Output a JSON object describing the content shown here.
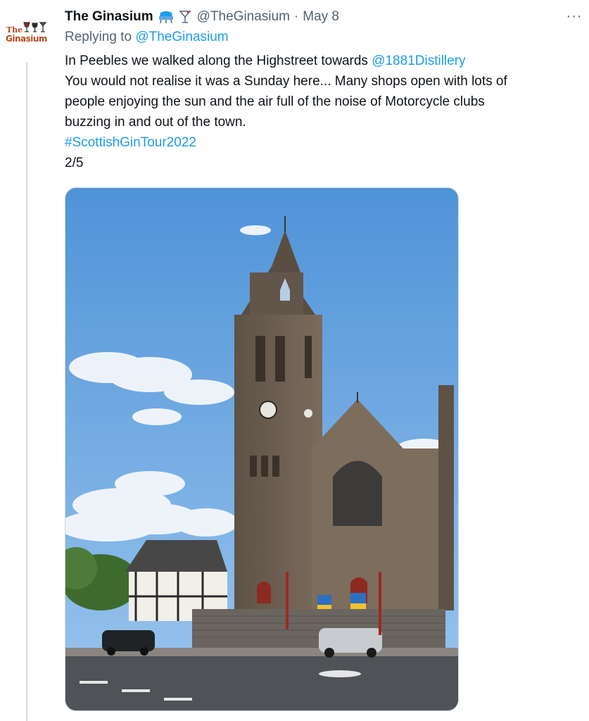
{
  "tweet": {
    "display_name": "The Ginasium",
    "handle": "@TheGinasium",
    "separator": "·",
    "date": "May 8",
    "replying_prefix": "Replying to",
    "replying_to": "@TheGinasium",
    "text": {
      "line1_prefix": "In Peebles we walked along the Highstreet towards ",
      "line1_mention": "@1881Distillery",
      "line2": "You would not realise it was a Sunday here... Many shops open with lots of",
      "line3": "people enjoying the sun and the air full of the noise of Motorcycle clubs",
      "line4": "buzzing in and out of the town.",
      "hashtag": "#ScottishGinTour2022",
      "counter": "2/5"
    },
    "more_label": "···",
    "emoji_icons": [
      "sofa-icon",
      "cocktail-glass-icon"
    ]
  },
  "avatar": {
    "logo_top": "The",
    "logo_bottom": "Ginasium"
  },
  "colors": {
    "link": "#1d9bf0",
    "secondary_text": "#536471",
    "primary_text": "#0f1419",
    "thread_line": "#cfd9de",
    "logo": "#b84a1b"
  },
  "media": {
    "description_icon": "church-photo"
  }
}
